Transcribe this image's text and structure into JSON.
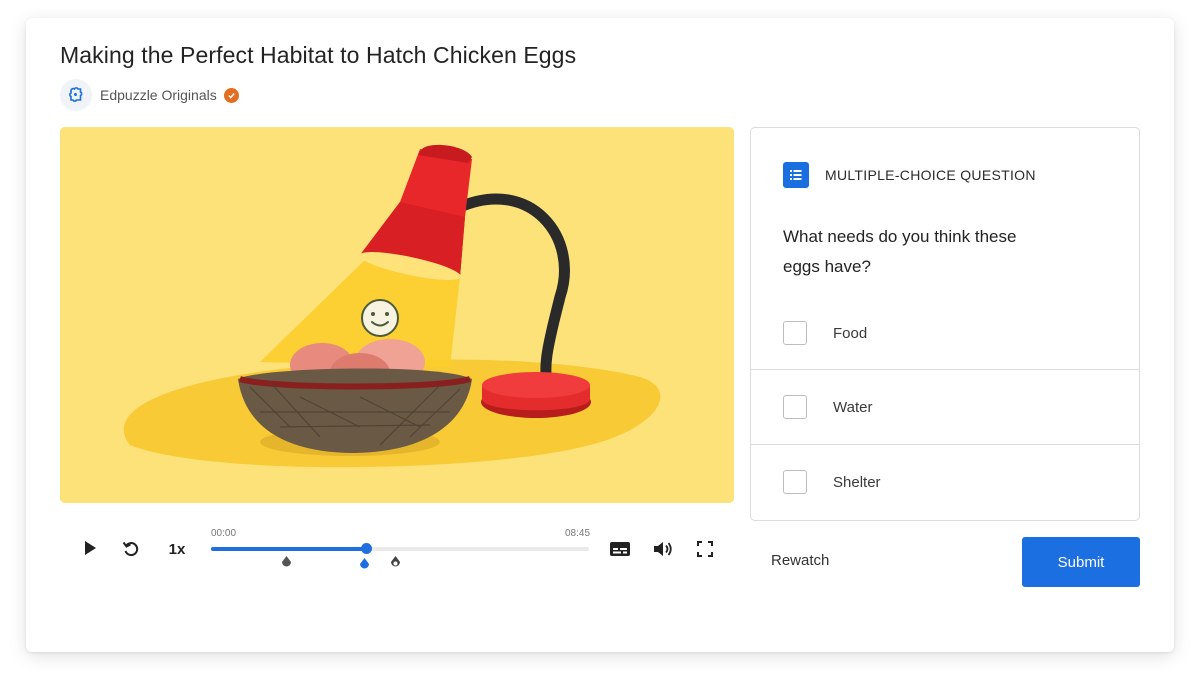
{
  "video": {
    "title": "Making the Perfect Habitat to Hatch Chicken Eggs",
    "channel": "Edpuzzle Originals"
  },
  "player": {
    "speed": "1x",
    "time_start": "00:00",
    "time_end": "08:45",
    "progress_percent": 41
  },
  "question": {
    "type_label": "MULTIPLE-CHOICE QUESTION",
    "text": "What needs do you think these eggs have?",
    "options": [
      "Food",
      "Water",
      "Shelter"
    ]
  },
  "actions": {
    "rewatch": "Rewatch",
    "submit": "Submit"
  },
  "colors": {
    "accent": "#1b6fe1",
    "video_bg": "#fde27a",
    "verified": "#e36d20"
  },
  "icons": [
    "puzzle-logo-icon",
    "verified-icon",
    "play-icon",
    "replay-icon",
    "captions-icon",
    "volume-icon",
    "fullscreen-icon",
    "list-icon",
    "question-marker-icon"
  ]
}
